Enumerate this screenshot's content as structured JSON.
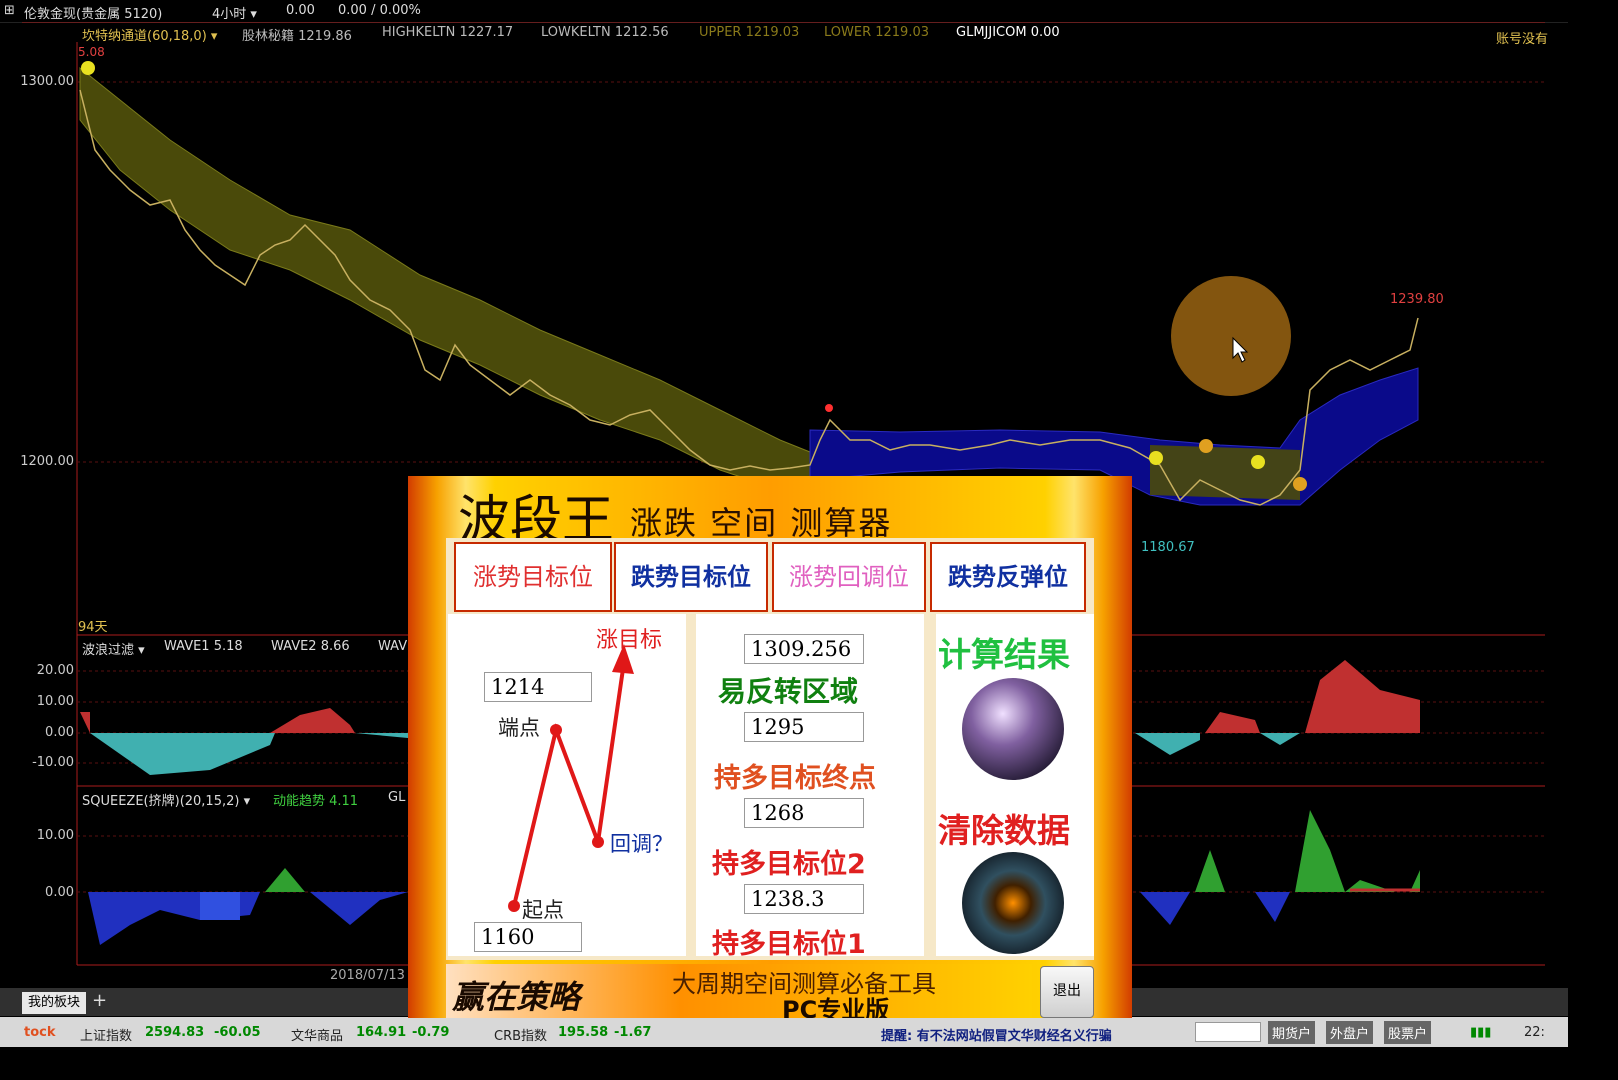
{
  "topbar": {
    "symbol": "伦敦金现(贵金属 5120)",
    "period": "4小时",
    "change": "0.00",
    "change_pct": "0.00 / 0.00%",
    "right_text": "账号没有"
  },
  "main_chart": {
    "indicator": "坎特纳通道(60,18,0)",
    "items": [
      {
        "text": "股林秘籍 1219.86",
        "color": "#bbbbbb"
      },
      {
        "text": "HIGHKELTN 1227.17",
        "color": "#bbbbbb"
      },
      {
        "text": "LOWKELTN 1212.56",
        "color": "#bbbbbb"
      },
      {
        "text": "UPPER 1219.03",
        "color": "#8a7a1a"
      },
      {
        "text": "LOWER 1219.03",
        "color": "#8a7a1a"
      },
      {
        "text": "GLMJJICOM 0.00",
        "color": "#ffffff"
      }
    ],
    "y_labels": [
      "1300.00",
      "1200.00"
    ],
    "top_left_value": "5.08",
    "high_label": "1239.80",
    "low_label": "1180.67",
    "days_label": "94天"
  },
  "wave_panel": {
    "indicator": "波浪过滤",
    "items": [
      "WAVE1 5.18",
      "WAVE2 8.66",
      "WAV"
    ],
    "y_labels": [
      "20.00",
      "10.00",
      "0.00",
      "-10.00"
    ]
  },
  "squeeze_panel": {
    "indicator": "SQUEEZE(挤牌)(20,15,2)",
    "item": "动能趋势 4.11",
    "item2": "GL",
    "y_labels": [
      "10.00",
      "0.00"
    ]
  },
  "x_axis": {
    "date": "2018/07/13"
  },
  "tabbar": {
    "tab": "我的板块",
    "add": "+"
  },
  "statusbar": {
    "brand": "tock",
    "indices": [
      {
        "name": "上证指数",
        "value": "2594.83",
        "change": "-60.05"
      },
      {
        "name": "文华商品",
        "value": "164.91",
        "change": "-0.79"
      },
      {
        "name": "CRB指数",
        "value": "195.58",
        "change": "-1.67"
      }
    ],
    "notice": "提醒: 有不法网站假冒文华财经名义行骗",
    "buttons": [
      "期货户",
      "外盘户",
      "股票户"
    ],
    "time": "22:"
  },
  "popup": {
    "title": "波段王",
    "subtitle": "涨跌 空间 测算器",
    "tabs": [
      "涨势目标位",
      "跌势目标位",
      "涨势回调位",
      "跌势反弹位"
    ],
    "diagram": {
      "target_label": "涨目标",
      "end_label": "端点",
      "pullback_label": "回调？",
      "start_label": "起点",
      "end_value": "1214",
      "start_value": "1160"
    },
    "results": {
      "value1": "1309.256",
      "label1": "易反转区域",
      "value2": "1295",
      "label2": "持多目标终点",
      "value3": "1268",
      "label3": "持多目标位2",
      "value4": "1238.3",
      "label4": "持多目标位1"
    },
    "calc_label": "计算结果",
    "clear_label": "清除数据",
    "banner_logo": "赢在策略",
    "banner_line1": "大周期空间测算必备工具",
    "banner_line2": "PC专业版",
    "exit_label": "退出"
  }
}
